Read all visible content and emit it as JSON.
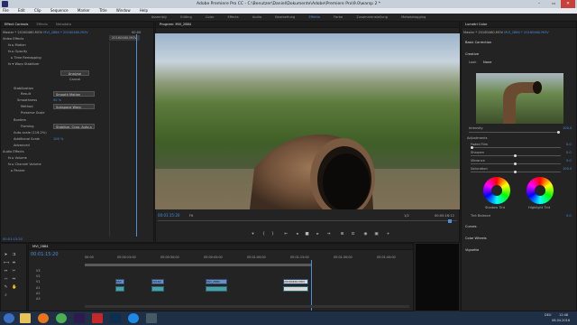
{
  "window": {
    "title": "Adobe Premiere Pro CC - C:\\Benutzer\\Daniel\\Dokumente\\Adobe\\Premiere Pro\\9.0\\warsp 2 *",
    "minimize": "–",
    "maximize": "▭",
    "close": "✕"
  },
  "menu": [
    "File",
    "Edit",
    "Clip",
    "Sequence",
    "Marker",
    "Title",
    "Window",
    "Help"
  ],
  "workspaces": {
    "items": [
      "Assembly",
      "Editing",
      "Color",
      "Effects",
      "Audio",
      "Bearbeitung",
      "Effekte",
      "Farbe",
      "Zusammenstellung",
      "Metadatagging"
    ],
    "active_index": 6
  },
  "effect_controls": {
    "tabs": [
      "Effect Controls",
      "Effects",
      "Metadata"
    ],
    "clip_path": "Master * 20160460.MOV",
    "clip_seq": "MVI_2884 * 20160460.MOV",
    "time_ruler": "00:00",
    "clip_name": "20160460.MOV",
    "section": "Video Effects",
    "rows": [
      "Motion",
      "Opacity",
      "Time Remapping",
      "Warp Stabilizer"
    ],
    "analyze_button": "Analyse",
    "cancel_button": "Cancel",
    "stab_label": "Stabilization",
    "result_label": "Result",
    "result_value": "Smooth Motion",
    "smooth_label": "Smoothness",
    "smooth_value": "50 %",
    "method_label": "Method",
    "method_value": "Subspace Warp",
    "preserve_label": "Preserve Scale",
    "borders_label": "Borders",
    "framing_label": "Framing",
    "framing_value": "Stabilize, Crop, Auto-s",
    "autoscale_label": "Auto-scale (116.2%)",
    "addscale_label": "Additional Scale",
    "addscale_value": "100 %",
    "advanced_label": "Advanced",
    "audio_section": "Audio Effects",
    "audio_rows": [
      "Volume",
      "Channel Volume",
      "Panner"
    ],
    "timecode": "00:01:15:20"
  },
  "monitor": {
    "tab": "Program: MVI_2884",
    "timecode_in": "00:01:15:20",
    "fit": "Fit",
    "quality": "1/2",
    "timecode_out": "00:00:18:12"
  },
  "lumetri": {
    "tabs": [
      "Lumetri Color"
    ],
    "clip": "Master * 20160460.MOV",
    "seq": "MVI_2884 * 20160460.MOV",
    "basic": "Basic Correction",
    "creative": "Creative",
    "look_label": "Look",
    "look_value": "None",
    "intensity_label": "Intensity",
    "intensity_value": "100.0",
    "adjustments": "Adjustments",
    "faded_label": "Faded Film",
    "faded_value": "0.0",
    "sharpen_label": "Sharpen",
    "sharpen_value": "0.0",
    "vibrance_label": "Vibrance",
    "vibrance_value": "0.0",
    "saturation_label": "Saturation",
    "saturation_value": "100.0",
    "shadow_tint": "Shadow Tint",
    "highlight_tint": "Highlight Tint",
    "tint_balance_label": "Tint Balance",
    "tint_balance_value": "0.0",
    "curves": "Curves",
    "color_wheels": "Color Wheels",
    "vignette": "Vignette"
  },
  "timeline": {
    "tab": "MVI_2884",
    "timecode": "00:01:15:20",
    "ruler": [
      "00:00",
      "00:00:15:00",
      "00:00:30:00",
      "00:00:45:00",
      "00:01:00:00",
      "00:01:15:00",
      "00:01:30:00",
      "00:01:45:00"
    ],
    "tracks": [
      {
        "name": "V3"
      },
      {
        "name": "V2"
      },
      {
        "name": "V1"
      },
      {
        "name": "A1"
      },
      {
        "name": "A2"
      },
      {
        "name": "A3"
      }
    ],
    "clips_v": [
      {
        "label": "MVI"
      },
      {
        "label": "20160"
      },
      {
        "label": "MVI_2884"
      },
      {
        "label": "20160460.MOV"
      }
    ],
    "clips_a": [
      {
        "label": ""
      },
      {
        "label": ""
      },
      {
        "label": ""
      },
      {
        "label": ""
      }
    ]
  },
  "taskbar": {
    "icons": [
      "Start",
      "Explorer",
      "Firefox",
      "Chrome",
      "Premiere Pro",
      "Acrobat",
      "Photoshop",
      "Skype",
      "Other"
    ],
    "lang": "DEU",
    "time": "12:48",
    "date": "08.04.2016"
  }
}
